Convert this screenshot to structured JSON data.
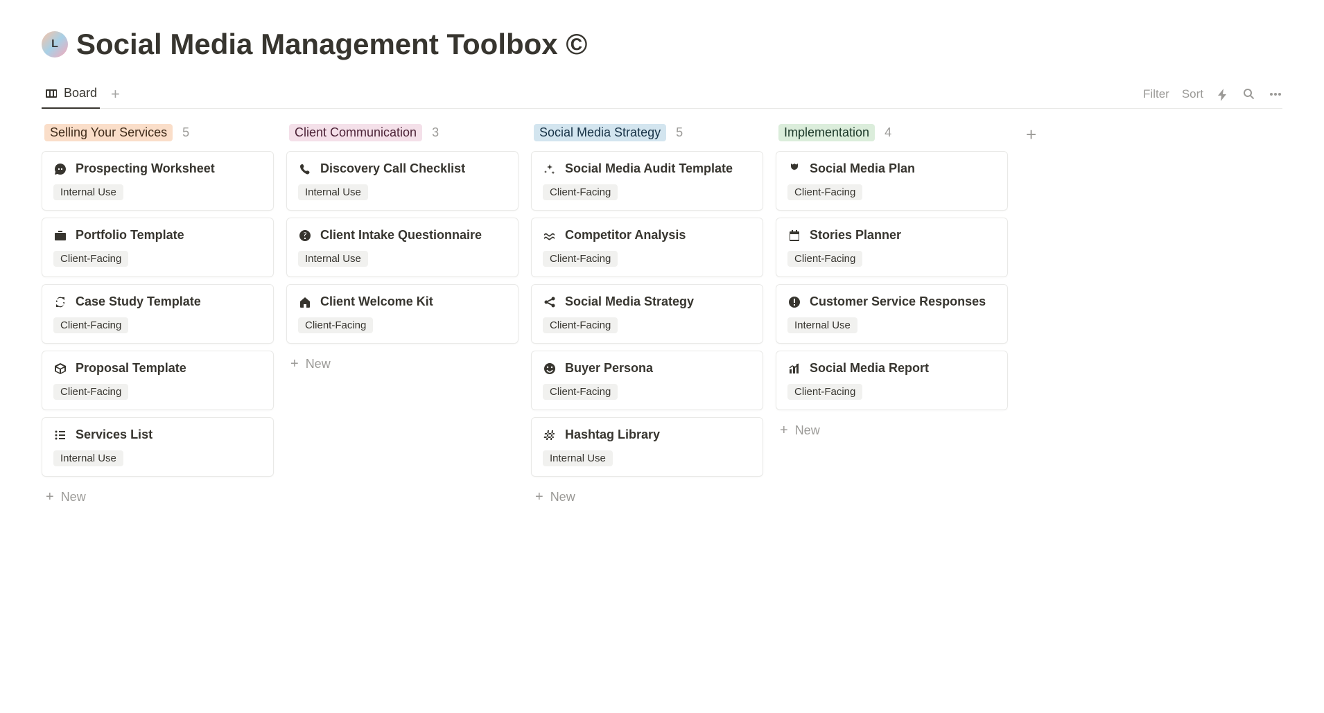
{
  "page": {
    "icon_letter": "L",
    "title": "Social Media Management Toolbox ©"
  },
  "tabs": {
    "active": "Board"
  },
  "toolbar": {
    "filter": "Filter",
    "sort": "Sort"
  },
  "new_label": "New",
  "tags": {
    "internal": "Internal Use",
    "client": "Client-Facing"
  },
  "columns": [
    {
      "label": "Selling Your Services",
      "color_bg": "#fadec9",
      "color_fg": "#402c1b",
      "count": "5",
      "cards": [
        {
          "icon": "chat",
          "title": "Prospecting Worksheet",
          "tag": "internal"
        },
        {
          "icon": "portfolio",
          "title": "Portfolio Template",
          "tag": "client"
        },
        {
          "icon": "refresh",
          "title": "Case Study Template",
          "tag": "client"
        },
        {
          "icon": "box",
          "title": "Proposal Template",
          "tag": "client"
        },
        {
          "icon": "list",
          "title": "Services List",
          "tag": "internal"
        }
      ]
    },
    {
      "label": "Client Communication",
      "color_bg": "#f4e0e9",
      "color_fg": "#4c2337",
      "count": "3",
      "cards": [
        {
          "icon": "phone",
          "title": "Discovery Call Checklist",
          "tag": "internal"
        },
        {
          "icon": "question",
          "title": "Client Intake Questionnaire",
          "tag": "internal"
        },
        {
          "icon": "home",
          "title": "Client Welcome Kit",
          "tag": "client"
        }
      ]
    },
    {
      "label": "Social Media Strategy",
      "color_bg": "#d3e5ef",
      "color_fg": "#183347",
      "count": "5",
      "cards": [
        {
          "icon": "sparkle",
          "title": "Social Media Audit Template",
          "tag": "client"
        },
        {
          "icon": "wave",
          "title": "Competitor Analysis",
          "tag": "client"
        },
        {
          "icon": "share",
          "title": "Social Media Strategy",
          "tag": "client"
        },
        {
          "icon": "smile",
          "title": "Buyer Persona",
          "tag": "client"
        },
        {
          "icon": "hash",
          "title": "Hashtag Library",
          "tag": "internal"
        }
      ]
    },
    {
      "label": "Implementation",
      "color_bg": "#dbeddb",
      "color_fg": "#1c3829",
      "count": "4",
      "cards": [
        {
          "icon": "badge",
          "title": "Social Media Plan",
          "tag": "client"
        },
        {
          "icon": "calendar",
          "title": "Stories Planner",
          "tag": "client"
        },
        {
          "icon": "exclaim",
          "title": "Customer Service Responses",
          "tag": "internal"
        },
        {
          "icon": "chart",
          "title": "Social Media Report",
          "tag": "client"
        }
      ]
    }
  ]
}
